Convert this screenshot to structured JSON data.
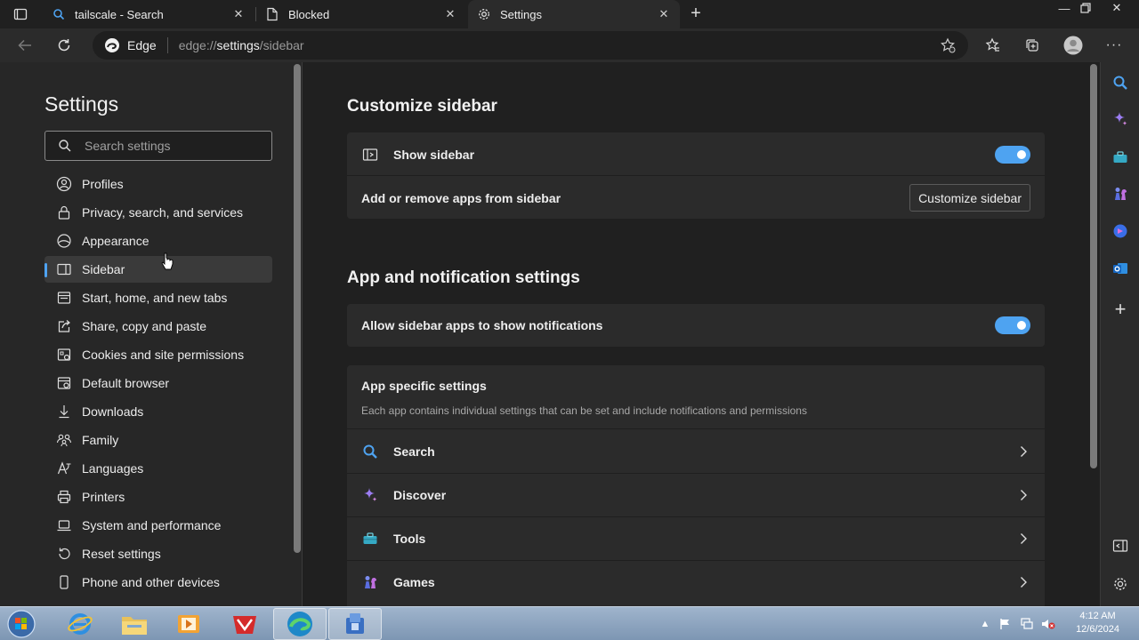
{
  "tabs": [
    {
      "title": "tailscale - Search",
      "icon": "search-icon"
    },
    {
      "title": "Blocked",
      "icon": "page-icon"
    },
    {
      "title": "Settings",
      "icon": "gear-icon"
    }
  ],
  "toolbar": {
    "browser_label": "Edge",
    "url_prefix": "edge://",
    "url_host": "settings",
    "url_path": "/sidebar"
  },
  "nav": {
    "title": "Settings",
    "search_placeholder": "Search settings",
    "items": [
      {
        "label": "Profiles",
        "icon": "profile-icon"
      },
      {
        "label": "Privacy, search, and services",
        "icon": "lock-icon"
      },
      {
        "label": "Appearance",
        "icon": "appearance-icon"
      },
      {
        "label": "Sidebar",
        "icon": "sidebar-icon"
      },
      {
        "label": "Start, home, and new tabs",
        "icon": "home-icon"
      },
      {
        "label": "Share, copy and paste",
        "icon": "share-icon"
      },
      {
        "label": "Cookies and site permissions",
        "icon": "cookie-icon"
      },
      {
        "label": "Default browser",
        "icon": "browser-icon"
      },
      {
        "label": "Downloads",
        "icon": "download-icon"
      },
      {
        "label": "Family",
        "icon": "family-icon"
      },
      {
        "label": "Languages",
        "icon": "language-icon"
      },
      {
        "label": "Printers",
        "icon": "printer-icon"
      },
      {
        "label": "System and performance",
        "icon": "laptop-icon"
      },
      {
        "label": "Reset settings",
        "icon": "reset-icon"
      },
      {
        "label": "Phone and other devices",
        "icon": "phone-icon"
      }
    ]
  },
  "main": {
    "customize": {
      "heading": "Customize sidebar",
      "show_sidebar_label": "Show sidebar",
      "show_sidebar_on": true,
      "add_remove_label": "Add or remove apps from sidebar",
      "customize_button": "Customize sidebar"
    },
    "notifications": {
      "heading": "App and notification settings",
      "allow_label": "Allow sidebar apps to show notifications",
      "allow_on": true
    },
    "app_specific": {
      "title": "App specific settings",
      "description": "Each app contains individual settings that can be set and include notifications and permissions",
      "apps": [
        {
          "label": "Search",
          "icon": "search-icon"
        },
        {
          "label": "Discover",
          "icon": "sparkle-icon"
        },
        {
          "label": "Tools",
          "icon": "toolbox-icon"
        },
        {
          "label": "Games",
          "icon": "chess-icon"
        }
      ]
    }
  },
  "taskbar": {
    "time": "4:12 AM",
    "date": "12/6/2024"
  }
}
